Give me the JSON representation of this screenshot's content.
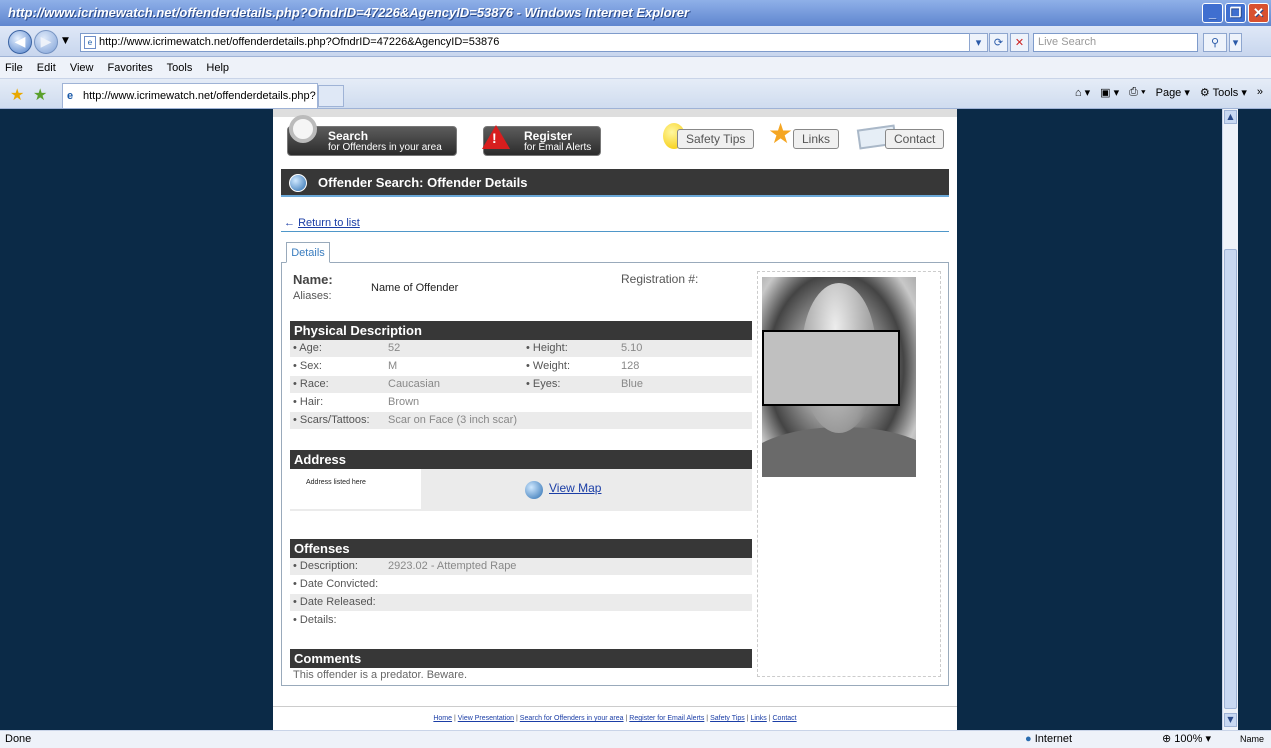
{
  "window": {
    "title": "http://www.icrimewatch.net/offenderdetails.php?OfndrID=47226&AgencyID=53876 - Windows Internet Explorer",
    "url": "http://www.icrimewatch.net/offenderdetails.php?OfndrID=47226&AgencyID=53876",
    "search_placeholder": "Live Search",
    "tab_label": "http://www.icrimewatch.net/offenderdetails.php?Ofn...",
    "menu": [
      "File",
      "Edit",
      "View",
      "Favorites",
      "Tools",
      "Help"
    ],
    "cmd": {
      "page": "Page",
      "tools": "Tools"
    },
    "status": {
      "left": "Done",
      "zone": "Internet",
      "zoom": "100%",
      "extra": "Name"
    }
  },
  "nav": {
    "search": {
      "title": "Search",
      "sub": "for Offenders in your area"
    },
    "register": {
      "title": "Register",
      "sub": "for Email Alerts"
    },
    "safety": "Safety Tips",
    "links": "Links",
    "contact": "Contact"
  },
  "header": {
    "title": "Offender Search: Offender Details"
  },
  "return_link": "Return to list",
  "tab": "Details",
  "offender": {
    "name_label": "Name:",
    "name": "Name of Offender",
    "aliases_label": "Aliases:",
    "registration_label": "Registration #:"
  },
  "physical": {
    "title": "Physical Description",
    "rows": [
      {
        "l1": "• Age:",
        "v1": "52",
        "l2": "• Height:",
        "v2": "5.10"
      },
      {
        "l1": "• Sex:",
        "v1": "M",
        "l2": "• Weight:",
        "v2": "128"
      },
      {
        "l1": "• Race:",
        "v1": "Caucasian",
        "l2": "• Eyes:",
        "v2": "Blue"
      },
      {
        "l1": "• Hair:",
        "v1": "Brown",
        "l2": "",
        "v2": ""
      },
      {
        "l1": "• Scars/Tattoos:",
        "v1": "Scar on Face (3 inch scar)",
        "l2": "",
        "v2": ""
      }
    ]
  },
  "address": {
    "title": "Address",
    "text": "Address listed here",
    "map_link": "View Map"
  },
  "offenses": {
    "title": "Offenses",
    "rows": [
      {
        "l": "• Description:",
        "v": "2923.02 - Attempted Rape"
      },
      {
        "l": "• Date Convicted:",
        "v": ""
      },
      {
        "l": "• Date Released:",
        "v": ""
      },
      {
        "l": "• Details:",
        "v": ""
      }
    ]
  },
  "comments": {
    "title": "Comments",
    "text": "This offender is a predator. Beware."
  },
  "footer": {
    "links": [
      "Home",
      "View Presentation",
      "Search for Offenders in your area",
      "Register for Email Alerts",
      "Safety Tips",
      "Links",
      "Contact"
    ]
  },
  "colors": {
    "background": "#0b2a47",
    "bar": "#373737",
    "accent": "#4f97c9",
    "link": "#1b3ea6"
  }
}
